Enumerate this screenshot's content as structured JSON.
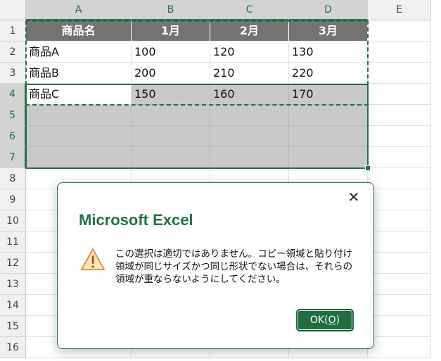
{
  "columns": [
    "A",
    "B",
    "C",
    "D",
    "E"
  ],
  "rows": [
    "1",
    "2",
    "3",
    "4",
    "5",
    "6",
    "7",
    "8",
    "9",
    "10",
    "11",
    "12",
    "13",
    "14",
    "15",
    "16"
  ],
  "table": {
    "header": [
      "商品名",
      "1月",
      "2月",
      "3月"
    ],
    "data": [
      [
        "商品A",
        "100",
        "120",
        "130"
      ],
      [
        "商品B",
        "200",
        "210",
        "220"
      ],
      [
        "商品C",
        "150",
        "160",
        "170"
      ]
    ]
  },
  "dialog": {
    "title": "Microsoft Excel",
    "message": "この選択は適切ではありません。コピー領域と貼り付け領域が同じサイズかつ同じ形状でない場合は、それらの領域が重ならないようにしてください。",
    "ok_label": "OK(O)",
    "ok_text": "OK(",
    "ok_mnemonic": "O",
    "ok_close": ")",
    "close_icon": "close-icon",
    "warning_icon": "warning-icon"
  },
  "colors": {
    "accent": "#217346",
    "header_fill": "#737373",
    "selection_shade": "#c9c9c9"
  }
}
